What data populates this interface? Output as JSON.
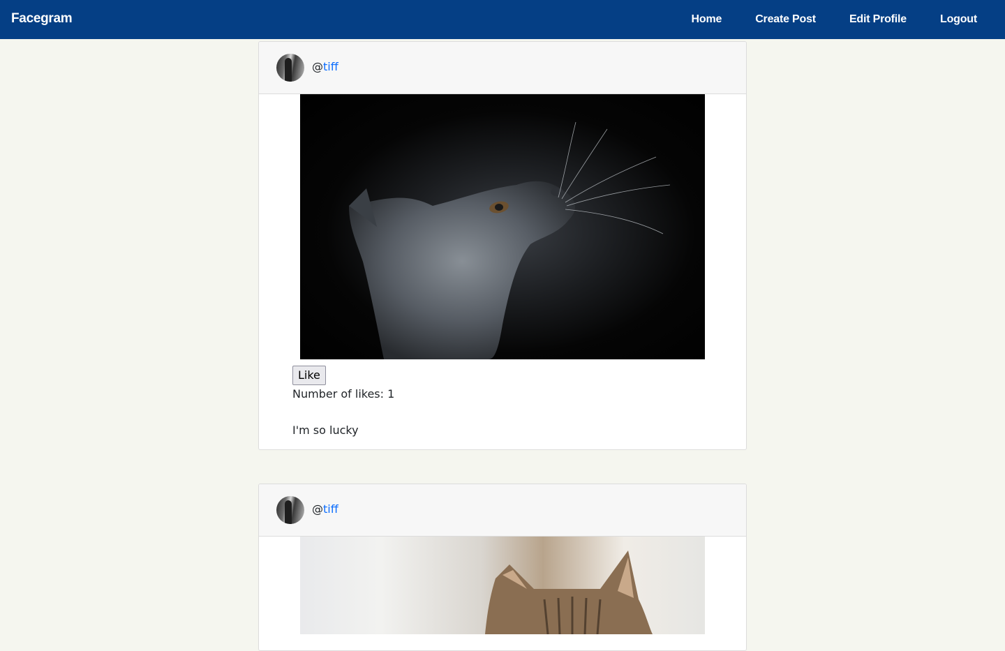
{
  "navbar": {
    "brand": "Facegram",
    "links": [
      "Home",
      "Create Post",
      "Edit Profile",
      "Logout"
    ]
  },
  "posts": [
    {
      "at": "@",
      "username": "tiff",
      "image": "gray-kitten-looking-up",
      "like_label": "Like",
      "likes_text": "Number of likes: 1",
      "caption": "I'm so lucky"
    },
    {
      "at": "@",
      "username": "tiff",
      "image": "tabby-cat"
    }
  ],
  "colors": {
    "navbar": "#053f85",
    "background": "#f5f6ef",
    "link": "#0d6efd"
  }
}
